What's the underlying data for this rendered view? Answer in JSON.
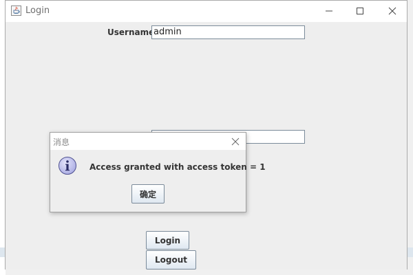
{
  "window": {
    "title": "Login",
    "controls": {
      "minimize_icon": "minimize-icon",
      "maximize_icon": "maximize-icon",
      "close_icon": "close-icon"
    }
  },
  "form": {
    "username_label": "Username",
    "username_value": "admin",
    "second_field_value": ""
  },
  "buttons": {
    "login_label": "Login",
    "logout_label": "Logout"
  },
  "dialog": {
    "title": "消息",
    "message": "Access granted with access token = 1",
    "ok_label": "确定",
    "icon": "info-icon"
  },
  "colors": {
    "window_bg": "#eeeeee",
    "titlebar_bg": "#ffffff",
    "button_gradient_bottom": "#dfe8f1",
    "info_icon_fill": "#b7b8ea"
  }
}
